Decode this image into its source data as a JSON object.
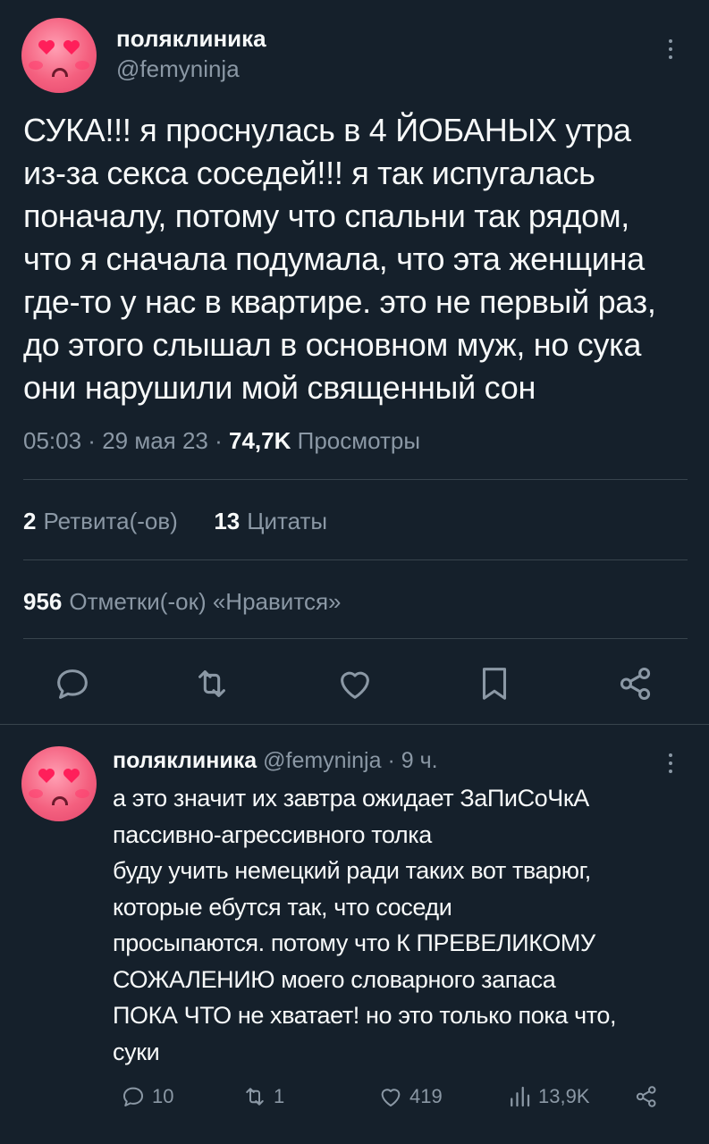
{
  "main_tweet": {
    "display_name": "поляклиника",
    "handle": "@femyninja",
    "text": "СУКА!!! я проснулась в 4 ЙОБАНЫХ утра\nиз-за секса соседей!!! я так испугалась\nпоначалу, потому что спальни так рядом,\nчто я сначала подумала, что эта женщина\nгде-то у нас в квартире. это не первый раз,\nдо этого слышал в основном муж, но сука\nони нарушили мой священный сон",
    "time": "05:03",
    "date": "29 мая 23",
    "views_count": "74,7K",
    "views_label": "Просмотры",
    "retweets_count": "2",
    "retweets_label": "Ретвита(-ов)",
    "quotes_count": "13",
    "quotes_label": "Цитаты",
    "likes_count": "956",
    "likes_label": "Отметки(-ок) «Нравится»",
    "icons": [
      "reply-icon",
      "retweet-icon",
      "like-icon",
      "bookmark-icon",
      "share-icon"
    ]
  },
  "reply_tweet": {
    "display_name": "поляклиника",
    "handle": "@femyninja",
    "age": "9 ч.",
    "text": "а это значит их завтра ожидает ЗаПиСоЧкА\nпассивно-агрессивного толка\nбуду учить немецкий ради таких вот тварюг,\nкоторые ебутся так, что соседи\nпросыпаются. потому что К ПРЕВЕЛИКОМУ\nСОЖАЛЕНИЮ моего словарного запаса\nПОКА ЧТО не хватает! но это только пока что,\nсуки",
    "replies_count": "10",
    "retweets_count": "1",
    "likes_count": "419",
    "views_count": "13,9K"
  },
  "colors": {
    "background": "#15202b",
    "text": "#f7f9f9",
    "secondary": "#8b98a5",
    "divider": "#38444d",
    "avatar_pink": "#f4607f"
  }
}
